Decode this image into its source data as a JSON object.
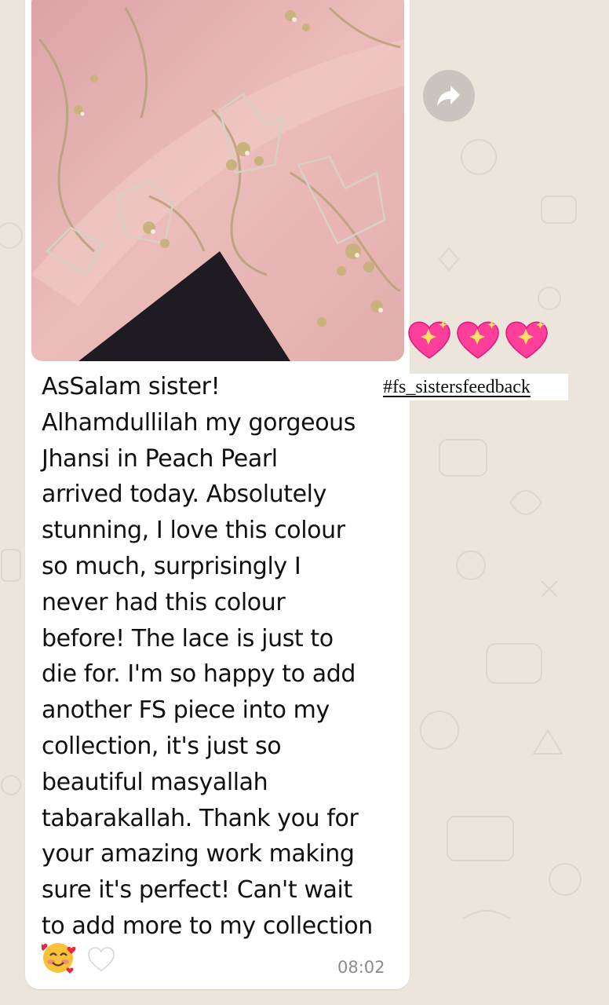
{
  "message": {
    "text": "AsSalam sister!\nAlhamdullilah my gorgeous\nJhansi in Peach Pearl\narrived today. Absolutely\nstunning, I love this colour\nso much, surprisingly I\nnever had this colour\nbefore! The lace is just to\ndie for. I'm so happy to add\nanother FS piece into my\ncollection, it's just so\nbeautiful masyallah\ntabarakallah. Thank you for\nyour amazing work making\nsure it's perfect! Can't wait\nto add more to my collection",
    "emojis": [
      "smiling-face-with-hearts",
      "white-heart"
    ],
    "time": "08:02"
  },
  "overlay": {
    "hashtag": "#fs_sistersfeedback",
    "sticker": "sparkling-heart x3"
  },
  "actions": {
    "forward_icon": "forward-arrow-icon"
  },
  "colors": {
    "wallpaper": "#ebe5dc",
    "bubble": "#ffffff",
    "fabric": "#e8b7b4",
    "timestamp": "#8b8b8b",
    "forward_button": "#c9c4bd",
    "heart": "#ff3d9a"
  }
}
